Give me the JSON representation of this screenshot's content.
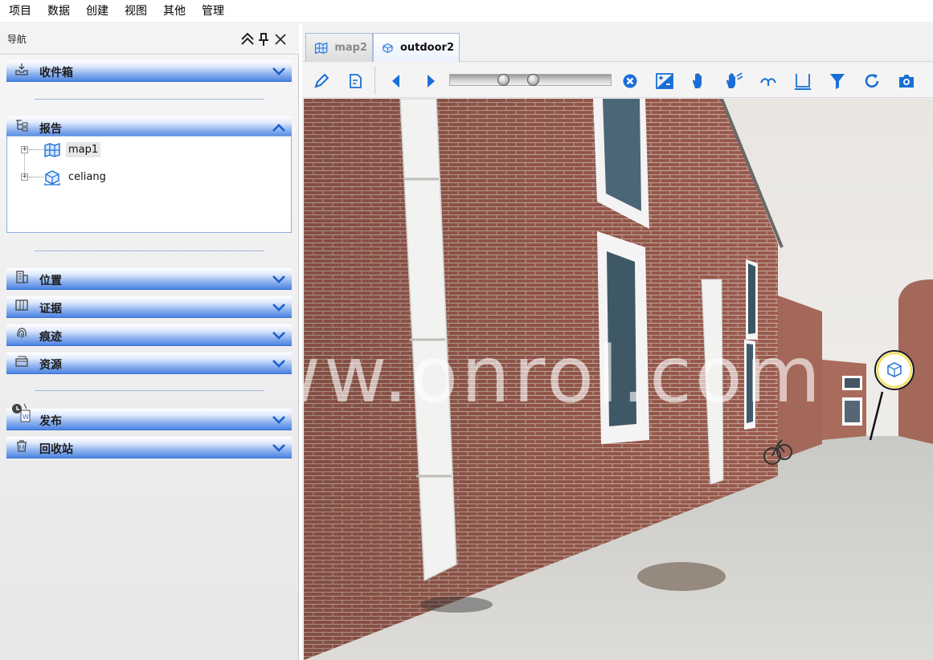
{
  "menu": {
    "items": [
      "项目",
      "数据",
      "创建",
      "视图",
      "其他",
      "管理"
    ]
  },
  "nav": {
    "title": "导航",
    "sections": {
      "inbox": "收件箱",
      "report": "报告",
      "location": "位置",
      "evidence": "证据",
      "traces": "痕迹",
      "resources": "资源",
      "publish": "发布",
      "recycle": "回收站"
    },
    "report_tree": [
      {
        "label": "map1",
        "icon": "map-icon"
      },
      {
        "label": "celiang",
        "icon": "measure-cube-icon"
      }
    ]
  },
  "tabs": [
    {
      "label": "map2",
      "icon": "map-icon",
      "active": false
    },
    {
      "label": "outdoor2",
      "icon": "cube-scene-icon",
      "active": true
    }
  ],
  "toolbar": {
    "icons": [
      "pencil-icon",
      "edit-doc-icon",
      "prev-icon",
      "next-icon",
      "slider",
      "clear-icon",
      "exposure-icon",
      "hand-icon",
      "multi-hand-icon",
      "curve-icon",
      "baseline-icon",
      "filter-icon",
      "refresh-icon",
      "camera-icon"
    ],
    "slider_knobs": [
      0.32,
      0.52
    ]
  },
  "watermark": "www.onrol.com",
  "colors": {
    "section_blue": "#4c84e3",
    "accent": "#1a6fd6"
  }
}
